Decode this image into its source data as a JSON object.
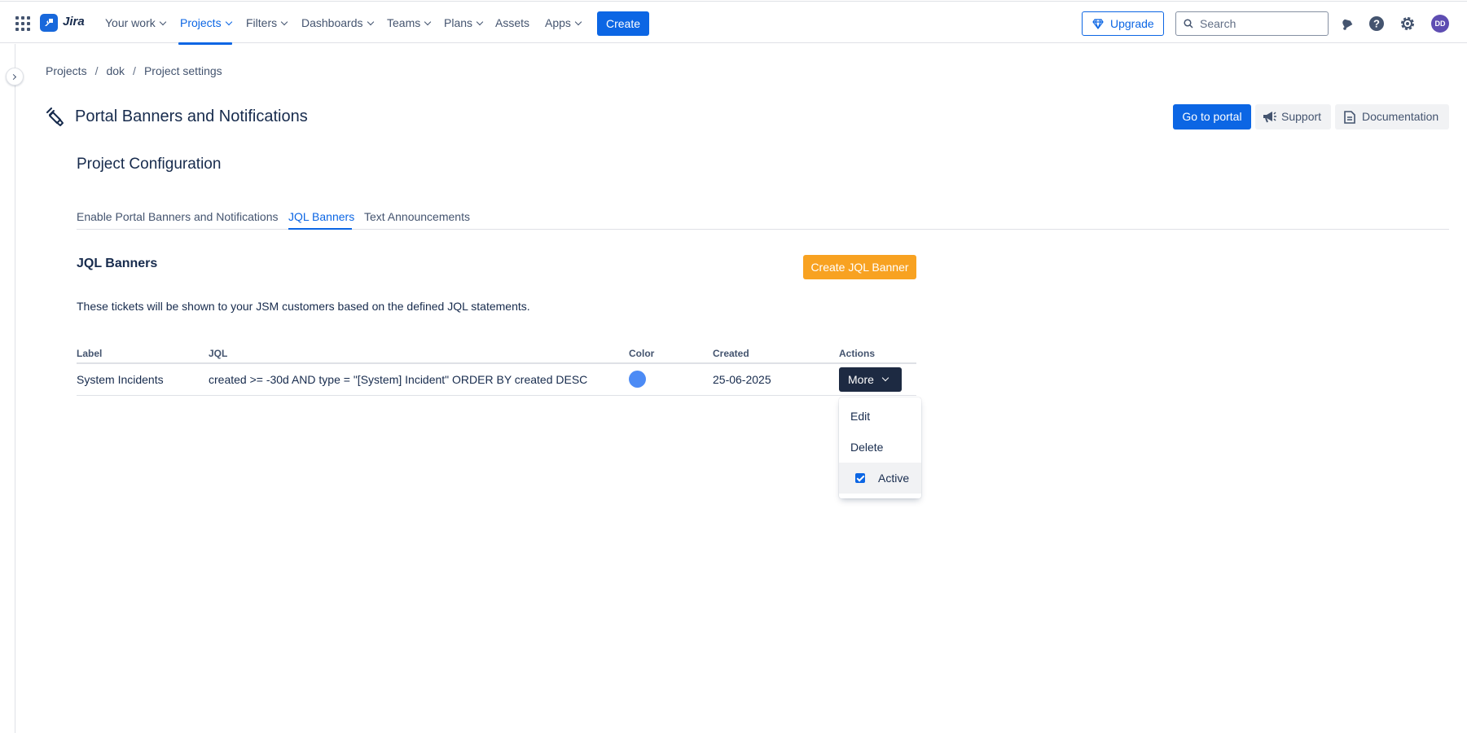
{
  "topnav": {
    "logo_text": "Jira",
    "items": [
      {
        "label": "Your work",
        "dropdown": true,
        "active": false
      },
      {
        "label": "Projects",
        "dropdown": true,
        "active": true
      },
      {
        "label": "Filters",
        "dropdown": true,
        "active": false
      },
      {
        "label": "Dashboards",
        "dropdown": true,
        "active": false
      },
      {
        "label": "Teams",
        "dropdown": true,
        "active": false
      },
      {
        "label": "Plans",
        "dropdown": true,
        "active": false
      },
      {
        "label": "Assets",
        "dropdown": false,
        "active": false
      },
      {
        "label": "Apps",
        "dropdown": true,
        "active": false
      }
    ],
    "create_label": "Create",
    "upgrade_label": "Upgrade",
    "search_placeholder": "Search",
    "avatar_initials": "DD",
    "icons": [
      "notifications-icon",
      "help-icon",
      "settings-icon"
    ]
  },
  "breadcrumb": [
    "Projects",
    "dok",
    "Project settings"
  ],
  "header": {
    "title": "Portal Banners and Notifications",
    "go_to_portal_label": "Go to portal",
    "support_label": "Support",
    "documentation_label": "Documentation"
  },
  "section_title": "Project Configuration",
  "tabs": [
    {
      "label": "Enable Portal Banners and Notifications",
      "active": false
    },
    {
      "label": "JQL Banners",
      "active": true
    },
    {
      "label": "Text Announcements",
      "active": false
    }
  ],
  "jql": {
    "heading": "JQL Banners",
    "create_button_label": "Create JQL Banner",
    "description": "These tickets will be shown to your JSM customers based on the defined JQL statements.",
    "columns": [
      "Label",
      "JQL",
      "Color",
      "Created",
      "Actions"
    ],
    "rows": [
      {
        "label": "System Incidents",
        "jql": "created >= -30d AND type = \"[System] Incident\" ORDER BY created DESC",
        "color": "#4c8bf5",
        "created": "25-06-2025",
        "action_label": "More"
      }
    ]
  },
  "dropdown": {
    "items": [
      {
        "label": "Edit"
      },
      {
        "label": "Delete"
      },
      {
        "label": "Active",
        "checked": true
      }
    ]
  },
  "colors": {
    "primary": "#0c66e4",
    "orange": "#f8a221",
    "dark_button": "#1d2a42",
    "avatar": "#5e4db2"
  }
}
